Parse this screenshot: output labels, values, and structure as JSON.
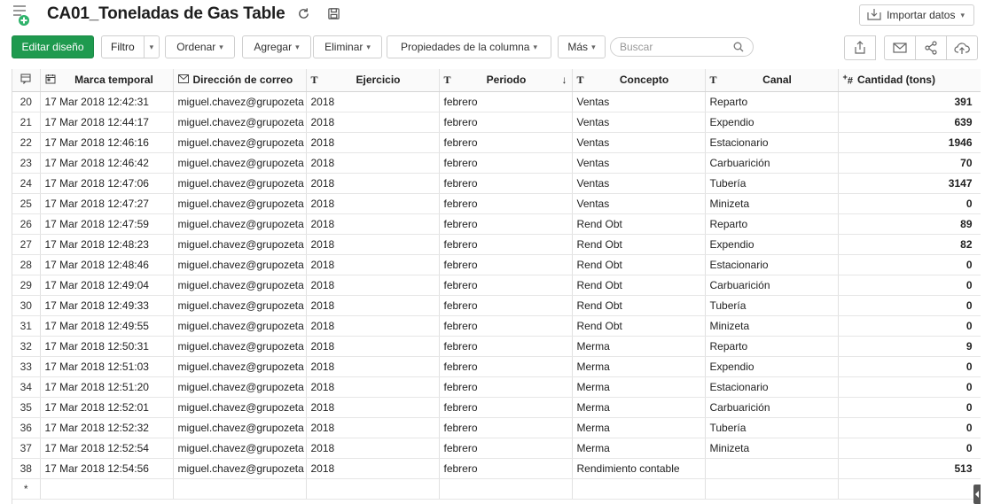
{
  "titlebar": {
    "title": "CA01_Toneladas de Gas Table",
    "import_label": "Importar datos"
  },
  "toolbar": {
    "edit_design": "Editar diseño",
    "filter": "Filtro",
    "sort": "Ordenar",
    "add": "Agregar",
    "delete": "Eliminar",
    "column_props": "Propiedades de la columna",
    "more": "Más",
    "search_placeholder": "Buscar"
  },
  "icons": {
    "app": "add-table-icon",
    "refresh": "refresh-icon",
    "save": "save-icon",
    "import": "import-icon",
    "export": "export-icon",
    "email": "email-icon",
    "share": "share-icon",
    "publish": "cloud-publish-icon",
    "search": "search-icon"
  },
  "colors": {
    "primary_button": "#1f9a4f",
    "app_icon_green": "#2fb36b"
  },
  "table": {
    "columns": [
      {
        "label": "Marca temporal",
        "type_icon": "date-icon"
      },
      {
        "label": "Dirección de correo",
        "type_icon": "email-type-icon"
      },
      {
        "label": "Ejercicio",
        "type_icon": "T"
      },
      {
        "label": "Periodo",
        "type_icon": "T",
        "sort": "↓"
      },
      {
        "label": "Concepto",
        "type_icon": "T"
      },
      {
        "label": "Canal",
        "type_icon": "T"
      },
      {
        "label": "Cantidad (tons)",
        "type_icon": "+#"
      }
    ],
    "rows": [
      [
        "20",
        "17 Mar 2018 12:42:31",
        "miguel.chavez@grupozeta",
        "2018",
        "febrero",
        "Ventas",
        "Reparto",
        "391"
      ],
      [
        "21",
        "17 Mar 2018 12:44:17",
        "miguel.chavez@grupozeta",
        "2018",
        "febrero",
        "Ventas",
        "Expendio",
        "639"
      ],
      [
        "22",
        "17 Mar 2018 12:46:16",
        "miguel.chavez@grupozeta",
        "2018",
        "febrero",
        "Ventas",
        "Estacionario",
        "1946"
      ],
      [
        "23",
        "17 Mar 2018 12:46:42",
        "miguel.chavez@grupozeta",
        "2018",
        "febrero",
        "Ventas",
        "Carbuarición",
        "70"
      ],
      [
        "24",
        "17 Mar 2018 12:47:06",
        "miguel.chavez@grupozeta",
        "2018",
        "febrero",
        "Ventas",
        "Tubería",
        "3147"
      ],
      [
        "25",
        "17 Mar 2018 12:47:27",
        "miguel.chavez@grupozeta",
        "2018",
        "febrero",
        "Ventas",
        "Minizeta",
        "0"
      ],
      [
        "26",
        "17 Mar 2018 12:47:59",
        "miguel.chavez@grupozeta",
        "2018",
        "febrero",
        "Rend Obt",
        "Reparto",
        "89"
      ],
      [
        "27",
        "17 Mar 2018 12:48:23",
        "miguel.chavez@grupozeta",
        "2018",
        "febrero",
        "Rend Obt",
        "Expendio",
        "82"
      ],
      [
        "28",
        "17 Mar 2018 12:48:46",
        "miguel.chavez@grupozeta",
        "2018",
        "febrero",
        "Rend Obt",
        "Estacionario",
        "0"
      ],
      [
        "29",
        "17 Mar 2018 12:49:04",
        "miguel.chavez@grupozeta",
        "2018",
        "febrero",
        "Rend Obt",
        "Carbuarición",
        "0"
      ],
      [
        "30",
        "17 Mar 2018 12:49:33",
        "miguel.chavez@grupozeta",
        "2018",
        "febrero",
        "Rend Obt",
        "Tubería",
        "0"
      ],
      [
        "31",
        "17 Mar 2018 12:49:55",
        "miguel.chavez@grupozeta",
        "2018",
        "febrero",
        "Rend Obt",
        "Minizeta",
        "0"
      ],
      [
        "32",
        "17 Mar 2018 12:50:31",
        "miguel.chavez@grupozeta",
        "2018",
        "febrero",
        "Merma",
        "Reparto",
        "9"
      ],
      [
        "33",
        "17 Mar 2018 12:51:03",
        "miguel.chavez@grupozeta",
        "2018",
        "febrero",
        "Merma",
        "Expendio",
        "0"
      ],
      [
        "34",
        "17 Mar 2018 12:51:20",
        "miguel.chavez@grupozeta",
        "2018",
        "febrero",
        "Merma",
        "Estacionario",
        "0"
      ],
      [
        "35",
        "17 Mar 2018 12:52:01",
        "miguel.chavez@grupozeta",
        "2018",
        "febrero",
        "Merma",
        "Carbuarición",
        "0"
      ],
      [
        "36",
        "17 Mar 2018 12:52:32",
        "miguel.chavez@grupozeta",
        "2018",
        "febrero",
        "Merma",
        "Tubería",
        "0"
      ],
      [
        "37",
        "17 Mar 2018 12:52:54",
        "miguel.chavez@grupozeta",
        "2018",
        "febrero",
        "Merma",
        "Minizeta",
        "0"
      ],
      [
        "38",
        "17 Mar 2018 12:54:56",
        "miguel.chavez@grupozeta",
        "2018",
        "febrero",
        "Rendimiento contable",
        "",
        "513"
      ]
    ],
    "new_row_marker": "*"
  }
}
